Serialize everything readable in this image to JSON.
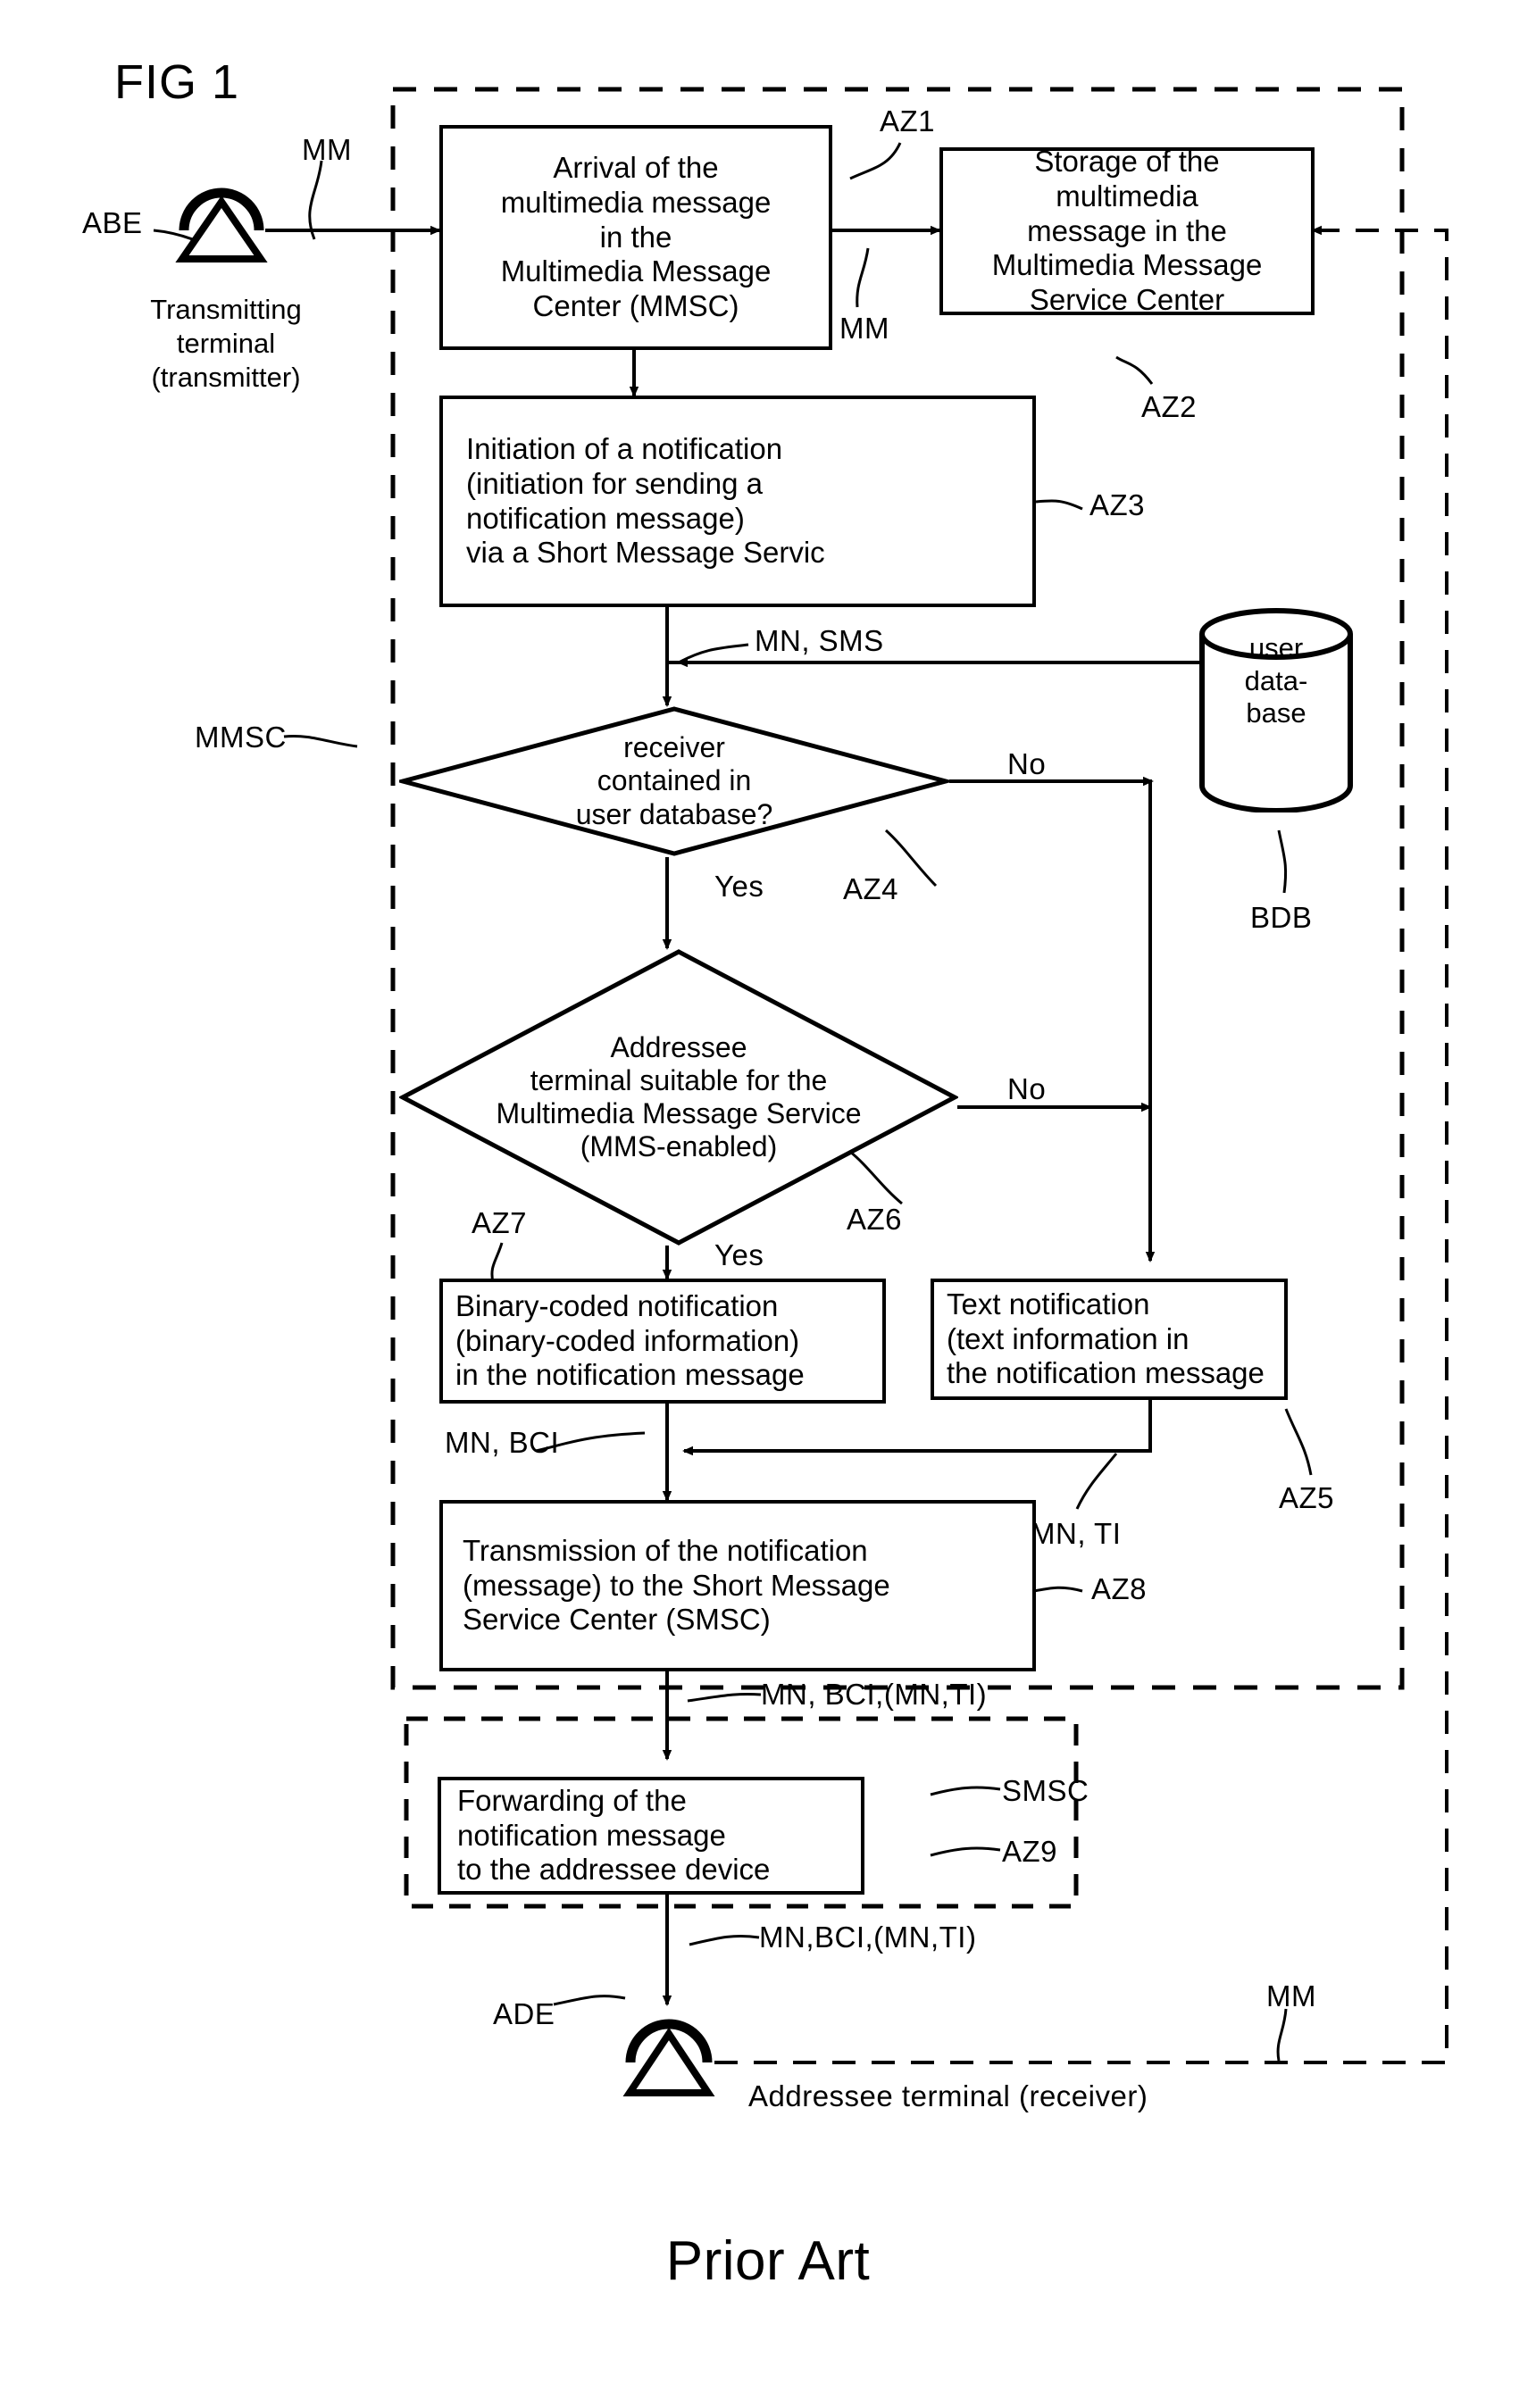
{
  "figure": {
    "label": "FIG 1",
    "footer": "Prior Art"
  },
  "terminals": {
    "transmitter": {
      "ref": "ABE",
      "caption_line1": "Transmitting",
      "caption_line2": "terminal",
      "caption_line3": "(transmitter)",
      "signal": "MM"
    },
    "addressee": {
      "ref": "ADE",
      "caption": "Addressee terminal (receiver)",
      "signal": "MM"
    }
  },
  "containers": {
    "mmsc_label": "MMSC",
    "smsc_label": "SMSC"
  },
  "blocks": [
    {
      "id": "AZ1",
      "ref": "AZ1",
      "lines": [
        "Arrival of the",
        "multimedia message",
        "in the",
        "Multimedia Message",
        "Center (MMSC)"
      ]
    },
    {
      "id": "AZ2",
      "ref": "AZ2",
      "lines": [
        "Storage of the",
        "multimedia",
        "message in the",
        "Multimedia Message",
        "Service Center"
      ]
    },
    {
      "id": "AZ3",
      "ref": "AZ3",
      "lines": [
        "Initiation of a notification",
        "(initiation for sending a",
        "notification message)",
        "via a Short Message Servic"
      ]
    },
    {
      "id": "AZ7",
      "ref": "AZ7",
      "lines": [
        "Binary-coded notification",
        "(binary-coded information)",
        "in the notification message"
      ]
    },
    {
      "id": "AZ5",
      "ref": "AZ5",
      "lines": [
        "Text notification",
        "(text information in",
        "the notification message"
      ]
    },
    {
      "id": "AZ8",
      "ref": "AZ8",
      "lines": [
        "Transmission of the notification",
        "(message) to the Short Message",
        "Service Center (SMSC)"
      ]
    },
    {
      "id": "AZ9",
      "ref": "AZ9",
      "lines": [
        "Forwarding of the",
        "notification message",
        "to the addressee device"
      ]
    }
  ],
  "decisions": [
    {
      "id": "AZ4",
      "ref": "AZ4",
      "lines": [
        "receiver",
        "contained in",
        "user database?"
      ],
      "yes": "Yes",
      "no": "No"
    },
    {
      "id": "AZ6",
      "ref": "AZ6",
      "lines": [
        "Addressee",
        "terminal suitable for the",
        "Multimedia Message Service",
        "(MMS-enabled)"
      ],
      "yes": "Yes",
      "no": "No"
    }
  ],
  "database": {
    "ref": "BDB",
    "lines": [
      "user",
      "data-",
      "base"
    ]
  },
  "signals": {
    "mm_in": "MM",
    "mm_store": "MM",
    "mn_sms": "MN, SMS",
    "mn_bci": "MN, BCI",
    "mn_ti": "MN, TI",
    "mn_bci_ti_1": "MN, BCI,(MN,TI)",
    "mn_bci_ti_2": "MN,BCI,(MN,TI)",
    "mm_return": "MM"
  },
  "colors": {
    "ink": "#000000",
    "paper": "#ffffff"
  }
}
